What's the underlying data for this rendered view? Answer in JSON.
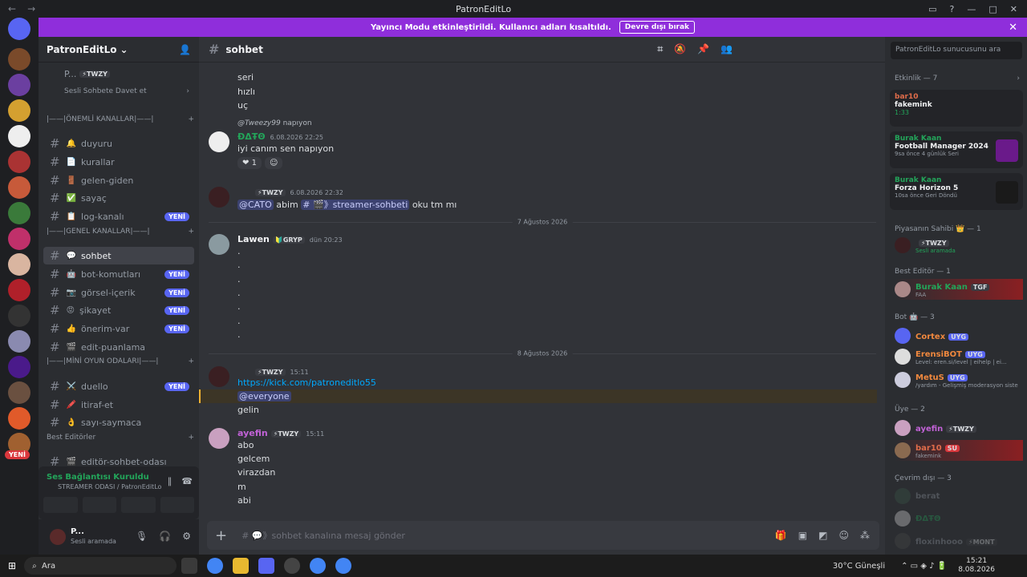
{
  "window": {
    "title": "PatronEditLo"
  },
  "banner": {
    "text": "Yayıncı Modu etkinleştirildi. Kullanıcı adları kısaltıldı.",
    "button": "Devre dışı bırak"
  },
  "server": {
    "name": "PatronEditLo",
    "voice_user": "P...",
    "voice_user_tag": "⚡TWZY",
    "invite": "Sesli Sohbete Davet et"
  },
  "categories": {
    "important": "|——|ÖNEMLİ KANALLAR|——|",
    "general": "|——|GENEL KANALLAR|——|",
    "games": "|——|MİNİ OYUN ODALARI|——|",
    "editors": "Best Editörler"
  },
  "channels": [
    {
      "name": "duyuru",
      "icon": "🔔",
      "new": false
    },
    {
      "name": "kurallar",
      "icon": "📄",
      "new": false
    },
    {
      "name": "gelen-giden",
      "icon": "🚪",
      "new": false
    },
    {
      "name": "sayaç",
      "icon": "✅",
      "new": false
    },
    {
      "name": "log-kanalı",
      "icon": "📋",
      "new": true
    },
    {
      "name": "sohbet",
      "icon": "💬",
      "new": false
    },
    {
      "name": "bot-komutları",
      "icon": "🤖",
      "new": true
    },
    {
      "name": "görsel-içerik",
      "icon": "📷",
      "new": true
    },
    {
      "name": "şikayet",
      "icon": "😡",
      "new": true
    },
    {
      "name": "önerim-var",
      "icon": "👍",
      "new": true
    },
    {
      "name": "edit-puanlama",
      "icon": "🎬",
      "new": false
    },
    {
      "name": "duello",
      "icon": "⚔️",
      "new": true
    },
    {
      "name": "itiraf-et",
      "icon": "🖍️",
      "new": false
    },
    {
      "name": "sayı-saymaca",
      "icon": "👌",
      "new": false
    },
    {
      "name": "editör-sohbet-odası",
      "icon": "🎬",
      "new": false
    }
  ],
  "new_label": "YENİ",
  "voice": {
    "status": "Ses Bağlantısı Kuruldu",
    "room": "STREAMER ODASI / PatronEditLo"
  },
  "user": {
    "name": "P...",
    "status": "Sesli aramada"
  },
  "chat": {
    "channel": "sohbet",
    "lines_top": [
      "seri",
      "hızlı",
      "uç"
    ],
    "reply": {
      "to": "@Tweezy99",
      "text": "napıyon"
    },
    "msg1": {
      "user": "ĐΔŦΘ",
      "time": "6.08.2026 22:25",
      "text": "iyi canım sen napıyon",
      "reaction": "1"
    },
    "msg2": {
      "tag": "⚡TWZY",
      "time": "6.08.2026 22:32",
      "mention": "@CATO",
      "text1": "abim",
      "channel_mention": "# 🎬》streamer-sohbeti",
      "text2": "oku tm mı"
    },
    "div1": "7 Ağustos 2026",
    "msg3": {
      "user": "Lawen",
      "tag": "🔰GRYP",
      "time": "dün 20:23",
      "dots": [
        ".",
        ".",
        ".",
        ".",
        ".",
        ".",
        "."
      ]
    },
    "div2": "8 Ağustos 2026",
    "msg4": {
      "tag": "⚡TWZY",
      "time": "15:11",
      "link": "https://kick.com/patroneditlo55",
      "everyone": "@everyone",
      "text": "gelin"
    },
    "msg5": {
      "user": "ayefin",
      "tag": "⚡TWZY",
      "time": "15:11",
      "lines": [
        "abo",
        "gelcem",
        "virazdan",
        "m",
        "abi"
      ]
    },
    "placeholder": "# 💬》sohbet kanalına mesaj gönder"
  },
  "members": {
    "search": "PatronEditLo sunucusunu ara",
    "activity_head": "Etkinlik — 7",
    "cards": [
      {
        "name": "bar10",
        "title": "fakemink",
        "sub": "1:33"
      },
      {
        "name": "Burak Kaan",
        "title": "Football Manager 2024",
        "sub": "9sa önce  4 günlük Seri"
      },
      {
        "name": "Burak Kaan",
        "title": "Forza Horizon 5",
        "sub": "10sa önce  Geri Döndü"
      }
    ],
    "owner_head": "Piyasanın Sahibi 👑 — 1",
    "owner": {
      "tag": "⚡TWZY",
      "sub": "Sesli aramada"
    },
    "editor_head": "Best Editör — 1",
    "editor": {
      "name": "Burak Kaan",
      "tag": "TGF",
      "sub": "FAA"
    },
    "bot_head": "Bot 🤖 — 3",
    "bots": [
      {
        "name": "Cortex",
        "tag": "UYG",
        "sub": ""
      },
      {
        "name": "ErensiBOT",
        "tag": "UYG",
        "sub": "Level: eren.si/level | eihelp | ei..."
      },
      {
        "name": "MetuS",
        "tag": "UYG",
        "sub": "/yardım - Gelişmiş moderasyon siste"
      }
    ],
    "member_head": "Üye — 2",
    "users": [
      {
        "name": "ayefin",
        "tag": "⚡TWZY",
        "sub": ""
      },
      {
        "name": "bar10",
        "tag": "SU",
        "sub": "fakemink"
      }
    ],
    "offline_head": "Çevrim dışı — 3",
    "offline": [
      {
        "name": "berat"
      },
      {
        "name": "ĐΔŦΘ"
      },
      {
        "name": "floxinhooo",
        "tag": "⚡MONT"
      }
    ]
  },
  "taskbar": {
    "search": "Ara",
    "weather": "30°C  Güneşli",
    "time": "15:21",
    "date": "8.08.2026"
  }
}
